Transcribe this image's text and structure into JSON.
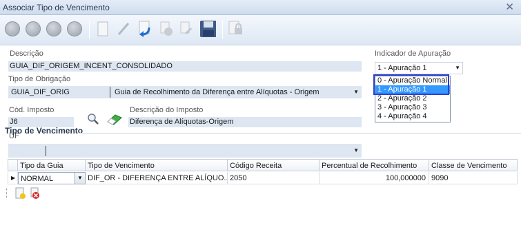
{
  "window": {
    "title": "Associar Tipo de Vencimento"
  },
  "form": {
    "descricao": {
      "label": "Descrição",
      "value": "GUIA_DIF_ORIGEM_INCENT_CONSOLIDADO"
    },
    "indicador": {
      "label": "Indicador de Apuração",
      "value": "1 - Apuração 1",
      "options": [
        "0 - Apuração Normal",
        "1 - Apuração 1",
        "2 - Apuração 2",
        "3 - Apuração 3",
        "4 - Apuração 4"
      ]
    },
    "tipo_obrigacao": {
      "label": "Tipo de Obrigação",
      "code": "GUIA_DIF_ORIG",
      "description": "Guia de Recolhimento da Diferença entre Alíquotas - Origem"
    },
    "cod_imposto": {
      "label": "Cód. Imposto",
      "value": "J6"
    },
    "descricao_imposto": {
      "label": "Descrição do Imposto",
      "value": "Diferença de Alíquotas-Origem"
    },
    "uf": {
      "label": "UF",
      "value": ""
    }
  },
  "section": {
    "title": "Tipo de Vencimento"
  },
  "grid": {
    "headers": [
      "Tipo da Guia",
      "Tipo de Vencimento",
      "Código Receita",
      "Percentual de Recolhimento",
      "Classe de Vencimento"
    ],
    "rows": [
      [
        "NORMAL",
        "DIF_OR - DIFERENÇA ENTRE ALÍQUO...",
        "2050",
        "100,000000",
        "9090"
      ]
    ]
  }
}
